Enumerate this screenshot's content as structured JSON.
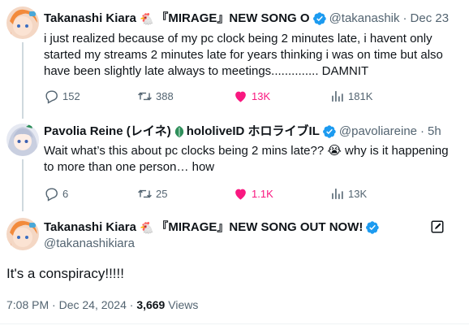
{
  "tweets": [
    {
      "name": "Takanashi Kiara",
      "name_suffix": "『MIRAGE』NEW SONG O",
      "name_emoji": "🐔",
      "handle": "@takanashik",
      "time": "Dec 23",
      "text": "i just realized because of my pc clock being 2 minutes late, i havent only started my streams 2 minutes late for years thinking i was on time but also have been slightly late always to meetings.............. DAMNIT",
      "replies": "152",
      "reposts": "388",
      "likes": "13K",
      "views": "181K"
    },
    {
      "name": "Pavolia Reine (レイネ)",
      "name_suffix": "hololiveID ホロライブIL",
      "handle": "@pavoliareine",
      "time": "5h",
      "text": "Wait what’s this about pc clocks being 2 mins late?? 😭 why is it happening to more than one person… how",
      "replies": "6",
      "reposts": "25",
      "likes": "1.1K",
      "views": "13K"
    }
  ],
  "main": {
    "name": "Takanashi Kiara",
    "name_suffix": "『MIRAGE』NEW SONG OUT NOW!",
    "name_emoji": "🐔",
    "handle": "@takanashikiara",
    "text": "It's a conspiracy!!!!!",
    "timestamp": "7:08 PM · Dec 24, 2024 · ",
    "views_count": "3,669",
    "views_label": " Views"
  },
  "separator": "·",
  "colors": {
    "verified": "#1d9bf0",
    "like_active": "#f91880",
    "muted": "#536471",
    "text": "#0f1419"
  },
  "icons": [
    "verified-badge-icon",
    "more-icon",
    "reply-icon",
    "repost-icon",
    "heart-icon",
    "views-icon",
    "edit-icon",
    "leaf-icon"
  ]
}
